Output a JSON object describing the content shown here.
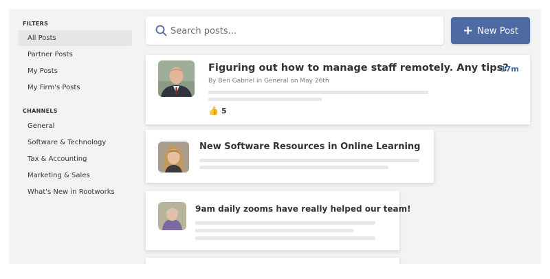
{
  "sidebar": {
    "filters_title": "FILTERS",
    "filters": [
      {
        "label": "All Posts",
        "active": true
      },
      {
        "label": "Partner Posts"
      },
      {
        "label": "My Posts"
      },
      {
        "label": "My Firm's Posts"
      }
    ],
    "channels_title": "CHANNELS",
    "channels": [
      {
        "label": "General"
      },
      {
        "label": "Software & Technology"
      },
      {
        "label": "Tax & Accounting"
      },
      {
        "label": "Marketing & Sales"
      },
      {
        "label": "What's New in Rootworks"
      }
    ]
  },
  "search": {
    "placeholder": "Search posts...",
    "icon": "search-icon"
  },
  "new_post_button": {
    "label": "New Post",
    "icon": "plus-icon",
    "color": "#4d6aa3"
  },
  "posts": [
    {
      "title": "Figuring out how to manage staff remotely. Any tips?",
      "meta": "By Ben Gabriel in General on May 26th",
      "time": "17m",
      "likes": "5",
      "like_icon": "thumbs-up-icon"
    },
    {
      "title": "New Software Resources in Online Learning"
    },
    {
      "title": "9am daily zooms have really helped our team!"
    }
  ],
  "colors": {
    "accent": "#4d6aa3",
    "time": "#3d6cad",
    "background": "#f3f3f3"
  }
}
